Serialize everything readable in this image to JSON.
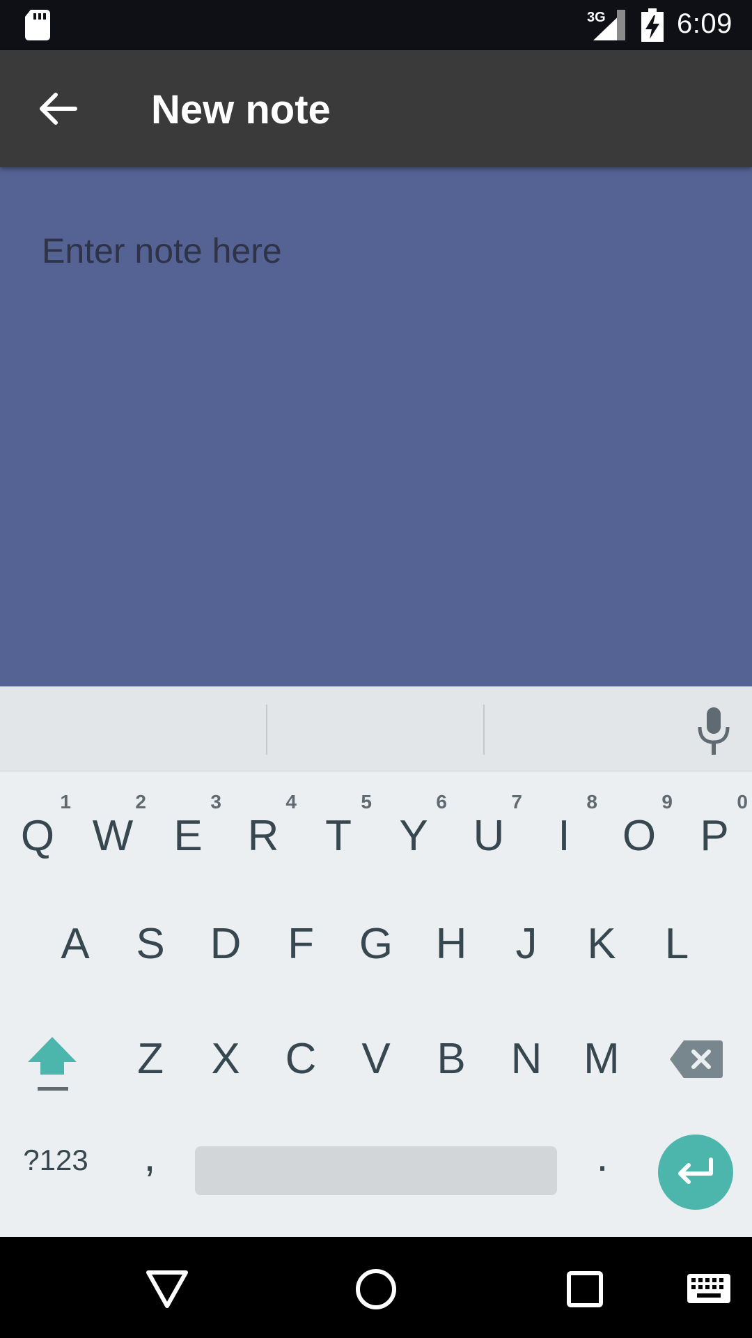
{
  "status_bar": {
    "network_label": "3G",
    "time": "6:09",
    "icons": [
      "sd-card-icon",
      "signal-icon",
      "battery-charging-icon"
    ]
  },
  "app_bar": {
    "title": "New note",
    "back_icon": "arrow-back-icon"
  },
  "note": {
    "placeholder": "Enter note here",
    "value": ""
  },
  "keyboard": {
    "row1": [
      {
        "letter": "Q",
        "hint": "1"
      },
      {
        "letter": "W",
        "hint": "2"
      },
      {
        "letter": "E",
        "hint": "3"
      },
      {
        "letter": "R",
        "hint": "4"
      },
      {
        "letter": "T",
        "hint": "5"
      },
      {
        "letter": "Y",
        "hint": "6"
      },
      {
        "letter": "U",
        "hint": "7"
      },
      {
        "letter": "I",
        "hint": "8"
      },
      {
        "letter": "O",
        "hint": "9"
      },
      {
        "letter": "P",
        "hint": "0"
      }
    ],
    "row2": [
      "A",
      "S",
      "D",
      "F",
      "G",
      "H",
      "J",
      "K",
      "L"
    ],
    "row3": [
      "Z",
      "X",
      "C",
      "V",
      "B",
      "N",
      "M"
    ],
    "symbols_label": "?123",
    "comma": ",",
    "period": ".",
    "accent_color": "#4db6ac"
  },
  "colors": {
    "note_background": "#556394",
    "app_bar": "#3a3a3a",
    "status_bar": "#0f1015",
    "keyboard_background": "#eceff1"
  }
}
